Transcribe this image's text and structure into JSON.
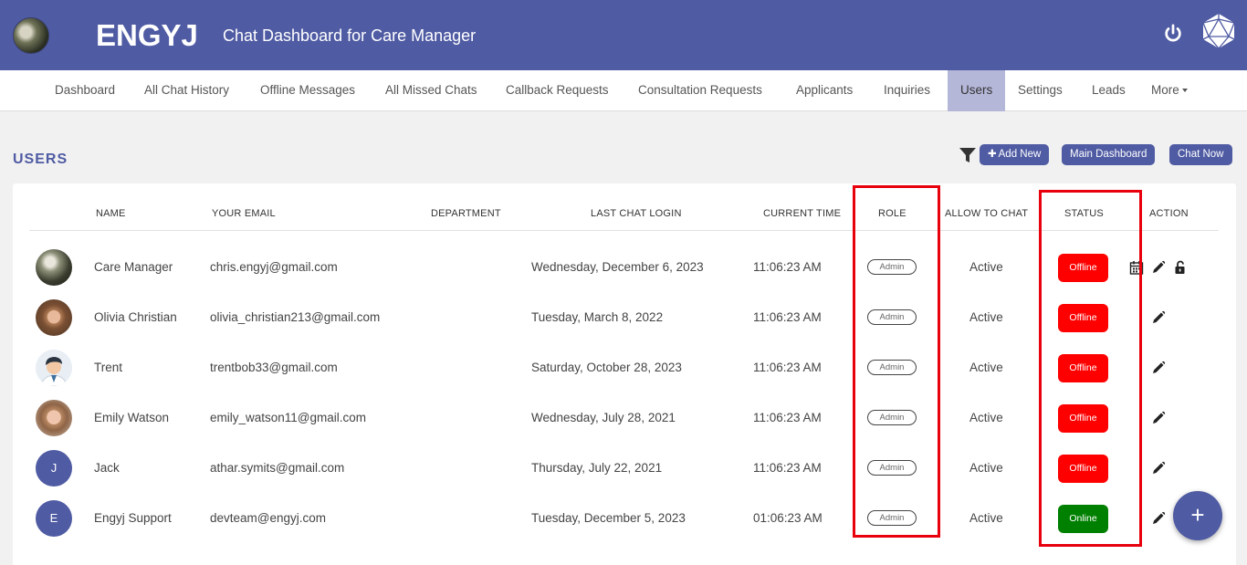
{
  "header": {
    "brand": "ENGYJ",
    "subtitle": "Chat Dashboard for Care Manager",
    "icons": [
      "avatar",
      "power-icon",
      "logo-icon"
    ]
  },
  "nav": {
    "items": [
      {
        "label": "Dashboard"
      },
      {
        "label": "All Chat History"
      },
      {
        "label": "Offline Messages"
      },
      {
        "label": "All Missed Chats"
      },
      {
        "label": "Callback Requests"
      },
      {
        "label": "Consultation Requests"
      },
      {
        "label": "Applicants"
      },
      {
        "label": "Inquiries"
      },
      {
        "label": "Users",
        "active": true
      },
      {
        "label": "Settings"
      },
      {
        "label": "Leads"
      },
      {
        "label": "More"
      }
    ]
  },
  "page": {
    "title": "USERS",
    "add_new": "Add New",
    "main_dashboard": "Main Dashboard",
    "chat_now": "Chat Now",
    "fab": "+"
  },
  "table": {
    "headers": [
      "NAME",
      "YOUR EMAIL",
      "DEPARTMENT",
      "LAST CHAT LOGIN",
      "CURRENT TIME",
      "ROLE",
      "ALLOW TO CHAT",
      "STATUS",
      "ACTION"
    ],
    "rows": [
      {
        "name": "Care Manager",
        "email": "chris.engyj@gmail.com",
        "department": "",
        "last_login": "Wednesday, December 6, 2023",
        "time": "11:06:23 AM",
        "role": "Admin",
        "allow": "Active",
        "status": "Offline",
        "avatar": "photo-landscape"
      },
      {
        "name": "Olivia Christian",
        "email": "olivia_christian213@gmail.com",
        "department": "",
        "last_login": "Tuesday, March 8, 2022",
        "time": "11:06:23 AM",
        "role": "Admin",
        "allow": "Active",
        "status": "Offline",
        "avatar": "photo-woman-glasses"
      },
      {
        "name": "Trent",
        "email": "trentbob33@gmail.com",
        "department": "",
        "last_login": "Saturday, October 28, 2023",
        "time": "11:06:23 AM",
        "role": "Admin",
        "allow": "Active",
        "status": "Offline",
        "avatar": "cartoon-man"
      },
      {
        "name": "Emily Watson",
        "email": "emily_watson11@gmail.com",
        "department": "",
        "last_login": "Wednesday, July 28, 2021",
        "time": "11:06:23 AM",
        "role": "Admin",
        "allow": "Active",
        "status": "Offline",
        "avatar": "photo-woman"
      },
      {
        "name": "Jack",
        "email": "athar.symits@gmail.com",
        "department": "",
        "last_login": "Thursday, July 22, 2021",
        "time": "11:06:23 AM",
        "role": "Admin",
        "allow": "Active",
        "status": "Offline",
        "avatar": "J"
      },
      {
        "name": "Engyj Support",
        "email": "devteam@engyj.com",
        "department": "",
        "last_login": "Tuesday, December 5, 2023",
        "time": "01:06:23 AM",
        "role": "Admin",
        "allow": "Active",
        "status": "Online",
        "avatar": "E"
      }
    ]
  },
  "colors": {
    "primary": "#4f5ba3",
    "offline": "#ff0000",
    "online": "#008000",
    "highlight": "#e8000d",
    "nav_active": "#b5b7d9"
  }
}
